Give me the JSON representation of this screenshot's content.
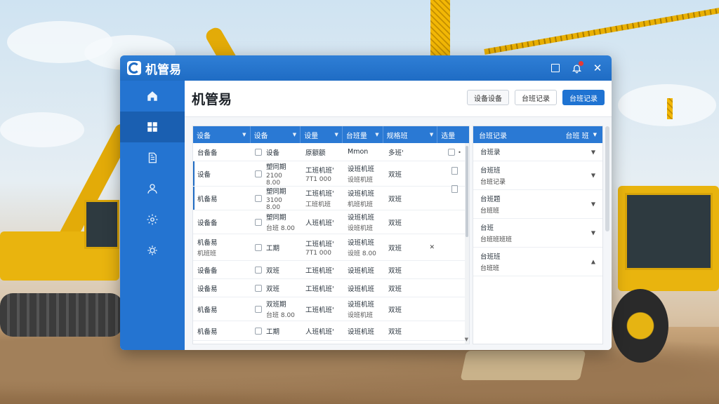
{
  "app": {
    "name": "机管易"
  },
  "page": {
    "title": "机管易"
  },
  "header_actions": {
    "btn1": "设备设备",
    "btn2": "台班记录",
    "btn3": "台班记录"
  },
  "table": {
    "columns": [
      "设备",
      "设备",
      "设量",
      "台班量",
      "规格班",
      "选量"
    ],
    "rows": [
      {
        "c1": "台备备",
        "c2": "设备",
        "c3": "原额额",
        "c4": "Mmon",
        "c5": "多班'",
        "c1sub": "",
        "c2sub": "",
        "c3sub": "",
        "c4sub": "",
        "c5sub": ""
      },
      {
        "c1": "设备",
        "c2": "塑同期",
        "c3": "工班机班'",
        "c4": "设班机班",
        "c5": "双班",
        "c1sub": "",
        "c2sub": "2100 8.00",
        "c3sub": "7T1 000",
        "c4sub": "设班机班",
        "c5sub": ""
      },
      {
        "c1": "机备易",
        "c2": "塑同期",
        "c3": "工班机班'",
        "c4": "设班机班",
        "c5": "双班",
        "c1sub": "",
        "c2sub": "3100 8.00",
        "c3sub": "工班机班",
        "c4sub": "机班机班",
        "c5sub": ""
      },
      {
        "c1": "设备备",
        "c2": "塑同期",
        "c3": "人班机班'",
        "c4": "设班机班",
        "c5": "双班",
        "c1sub": "",
        "c2sub": "台班 8.00",
        "c3sub": "",
        "c4sub": "设班机班",
        "c5sub": ""
      },
      {
        "c1": "机备易",
        "c2": "工期",
        "c3": "工班机班'",
        "c4": "设班机班",
        "c5": "双班",
        "c1sub": "机班班",
        "c2sub": "",
        "c3sub": "7T1 000",
        "c4sub": "设班 8.00",
        "c5sub": ""
      },
      {
        "c1": "设备备",
        "c2": "双班",
        "c3": "工班机班'",
        "c4": "设班机班",
        "c5": "双班",
        "c1sub": "",
        "c2sub": "",
        "c3sub": "",
        "c4sub": "",
        "c5sub": ""
      },
      {
        "c1": "设备易",
        "c2": "双班",
        "c3": "工班机班'",
        "c4": "设班机班",
        "c5": "双班",
        "c1sub": "",
        "c2sub": "",
        "c3sub": "",
        "c4sub": "",
        "c5sub": ""
      },
      {
        "c1": "机备易",
        "c2": "双班期",
        "c3": "工班机班'",
        "c4": "设班机班",
        "c5": "双班",
        "c1sub": "",
        "c2sub": "台班 8.00",
        "c3sub": "",
        "c4sub": "设班机班",
        "c5sub": ""
      },
      {
        "c1": "机备易",
        "c2": "工期",
        "c3": "人班机班'",
        "c4": "设班机班",
        "c5": "双班",
        "c1sub": "",
        "c2sub": "",
        "c3sub": "",
        "c4sub": "",
        "c5sub": ""
      }
    ]
  },
  "panel": {
    "title": "台班记录",
    "filter": "台班 班",
    "items": [
      {
        "title": "台班录",
        "sub": ""
      },
      {
        "title": "台班班",
        "sub": "台班记录"
      },
      {
        "title": "台班题",
        "sub": "台班班"
      },
      {
        "title": "台班",
        "sub": "台班班班班"
      },
      {
        "title": "台班班",
        "sub": "台班班"
      }
    ]
  },
  "icons": {
    "sidebar": [
      "home-icon",
      "dashboard-icon",
      "document-icon",
      "user-icon",
      "gear-icon",
      "settings-icon"
    ],
    "titlebar": [
      "maximize-icon",
      "bell-icon",
      "close-icon"
    ]
  },
  "colors": {
    "primary": "#1f6cc4",
    "sidebar": "#2474d1",
    "header_row": "#2a79d4",
    "notification": "#e53935"
  }
}
